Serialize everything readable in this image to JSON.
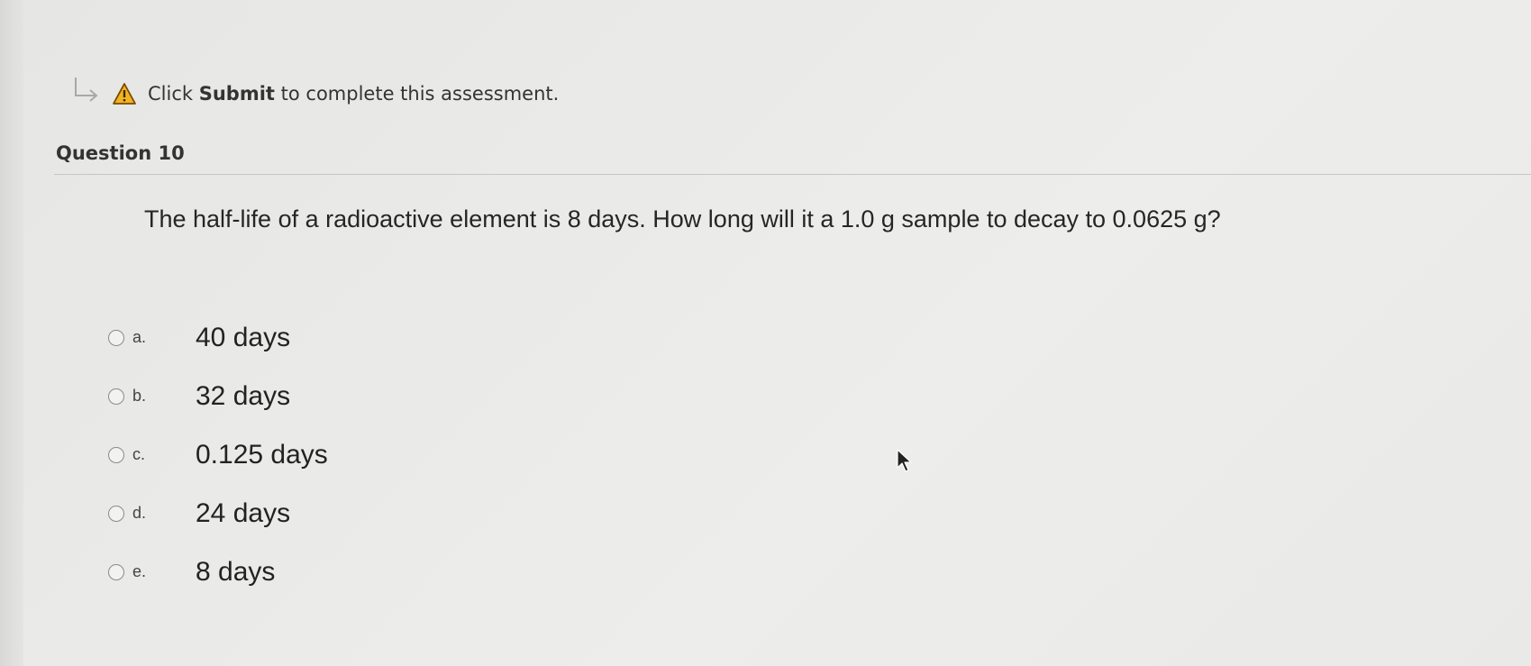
{
  "notice": {
    "prefix": "Click",
    "bold": "Submit",
    "suffix": "to complete this assessment."
  },
  "question": {
    "header": "Question 10",
    "text": "The half-life of a radioactive element is 8 days. How long will it a 1.0 g sample to decay to 0.0625 g?",
    "options": [
      {
        "letter": "a.",
        "text": "40 days"
      },
      {
        "letter": "b.",
        "text": "32 days"
      },
      {
        "letter": "c.",
        "text": "0.125 days"
      },
      {
        "letter": "d.",
        "text": "24 days"
      },
      {
        "letter": "e.",
        "text": "8 days"
      }
    ]
  },
  "icons": {
    "arrow": "return-arrow-icon",
    "warning": "warning-icon",
    "cursor": "mouse-cursor-icon"
  },
  "colors": {
    "warning_fill": "#f0b323",
    "background": "#e9e9e7"
  }
}
